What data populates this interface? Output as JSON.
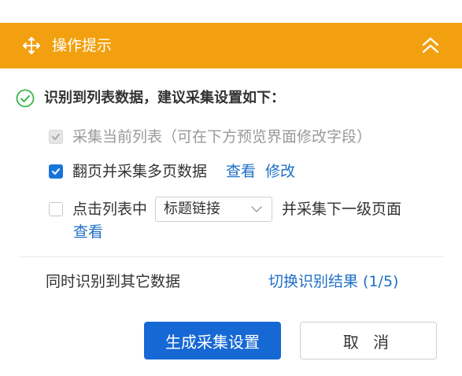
{
  "header": {
    "title": "操作提示",
    "move_icon": "move-icon",
    "collapse_icon": "chevron-double-up-icon",
    "color": "#f2a00f"
  },
  "summary": {
    "text": "识别到列表数据，建议采集设置如下：",
    "icon": "check-circle-icon"
  },
  "options": {
    "collect_current": {
      "label": "采集当前列表（可在下方预览界面修改字段）",
      "checked": true,
      "disabled": true
    },
    "paginate": {
      "label": "翻页并采集多页数据",
      "checked": true,
      "view_link": "查看",
      "edit_link": "修改"
    },
    "click_list": {
      "label_prefix": "点击列表中",
      "select_value": "标题链接",
      "label_suffix": "并采集下一级页面",
      "checked": false,
      "view_link": "查看"
    }
  },
  "other_data": {
    "label": "同时识别到其它数据",
    "switch_link": "切换识别结果 (1/5)"
  },
  "actions": {
    "generate": "生成采集设置",
    "cancel": "取 消"
  },
  "colors": {
    "primary": "#1668d4",
    "link": "#1f6fc5",
    "success": "#3bb54a"
  }
}
